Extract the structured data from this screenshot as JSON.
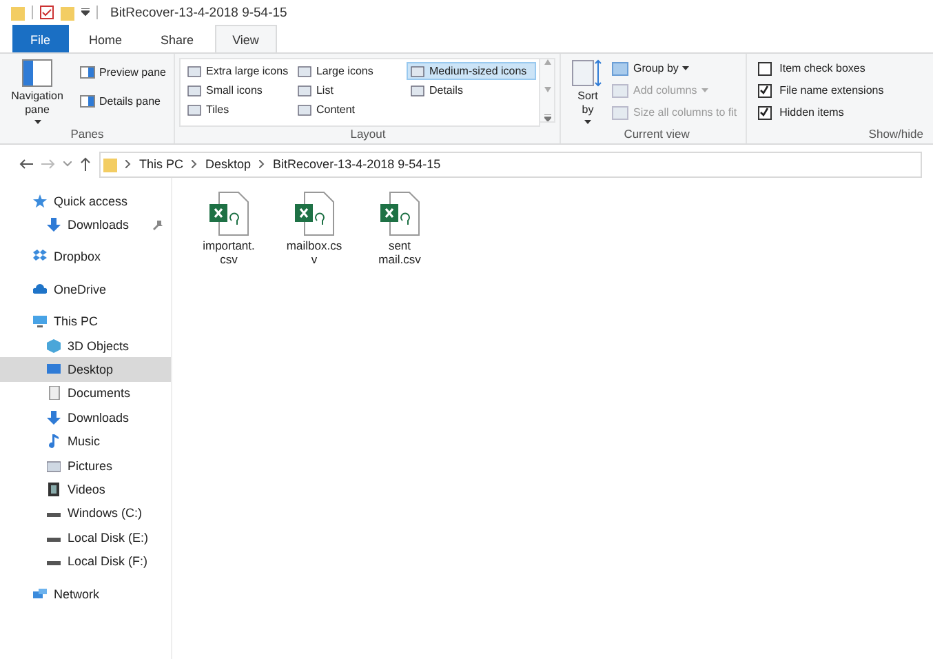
{
  "window": {
    "title": "BitRecover-13-4-2018 9-54-15"
  },
  "tabs": [
    {
      "label": "File",
      "selected": false,
      "kind": "file"
    },
    {
      "label": "Home",
      "selected": false,
      "kind": "tab"
    },
    {
      "label": "Share",
      "selected": false,
      "kind": "tab"
    },
    {
      "label": "View",
      "selected": true,
      "kind": "tab"
    }
  ],
  "ribbon": {
    "panes": {
      "label": "Panes",
      "navigation_pane": "Navigation pane",
      "items": [
        "Preview pane",
        "Details pane"
      ]
    },
    "layout": {
      "label": "Layout",
      "items": [
        {
          "label": "Extra large icons",
          "selected": false
        },
        {
          "label": "Small icons",
          "selected": false
        },
        {
          "label": "Tiles",
          "selected": false
        },
        {
          "label": "Large icons",
          "selected": false
        },
        {
          "label": "List",
          "selected": false
        },
        {
          "label": "Content",
          "selected": false
        },
        {
          "label": "Medium-sized icons",
          "selected": true
        },
        {
          "label": "Details",
          "selected": false
        }
      ]
    },
    "current_view": {
      "label": "Current view",
      "sort_by": "Sort by",
      "items": [
        {
          "label": "Group by",
          "disabled": false,
          "dropdown": true
        },
        {
          "label": "Add columns",
          "disabled": true,
          "dropdown": true
        },
        {
          "label": "Size all columns to fit",
          "disabled": true,
          "dropdown": false
        }
      ]
    },
    "show_hide": {
      "label": "Show/hide",
      "items": [
        {
          "label": "Item check boxes",
          "checked": false
        },
        {
          "label": "File name extensions",
          "checked": true
        },
        {
          "label": "Hidden items",
          "checked": true
        }
      ]
    }
  },
  "address_bar": {
    "path": [
      "This PC",
      "Desktop",
      "BitRecover-13-4-2018 9-54-15"
    ]
  },
  "sidebar": {
    "items": [
      {
        "label": "Quick access",
        "kind": "star",
        "selected": false,
        "children": [
          {
            "label": "Downloads",
            "kind": "download",
            "selected": false,
            "pinned": true
          }
        ]
      },
      {
        "label": "Dropbox",
        "kind": "dropbox",
        "selected": false
      },
      {
        "label": "OneDrive",
        "kind": "cloud",
        "selected": false
      },
      {
        "label": "This PC",
        "kind": "pc",
        "selected": false,
        "children": [
          {
            "label": "3D Objects",
            "kind": "cube",
            "selected": false
          },
          {
            "label": "Desktop",
            "kind": "desktop",
            "selected": true
          },
          {
            "label": "Documents",
            "kind": "doc",
            "selected": false
          },
          {
            "label": "Downloads",
            "kind": "download",
            "selected": false
          },
          {
            "label": "Music",
            "kind": "music",
            "selected": false
          },
          {
            "label": "Pictures",
            "kind": "pictures",
            "selected": false
          },
          {
            "label": "Videos",
            "kind": "videos",
            "selected": false
          },
          {
            "label": "Windows (C:)",
            "kind": "drive",
            "selected": false
          },
          {
            "label": "Local Disk (E:)",
            "kind": "drive",
            "selected": false
          },
          {
            "label": "Local Disk (F:)",
            "kind": "drive",
            "selected": false
          }
        ]
      },
      {
        "label": "Network",
        "kind": "network",
        "selected": false
      }
    ]
  },
  "files": [
    {
      "name_lines": [
        "important.",
        "csv"
      ]
    },
    {
      "name_lines": [
        "mailbox.cs",
        "v"
      ]
    },
    {
      "name_lines": [
        "sent",
        "mail.csv"
      ]
    }
  ]
}
